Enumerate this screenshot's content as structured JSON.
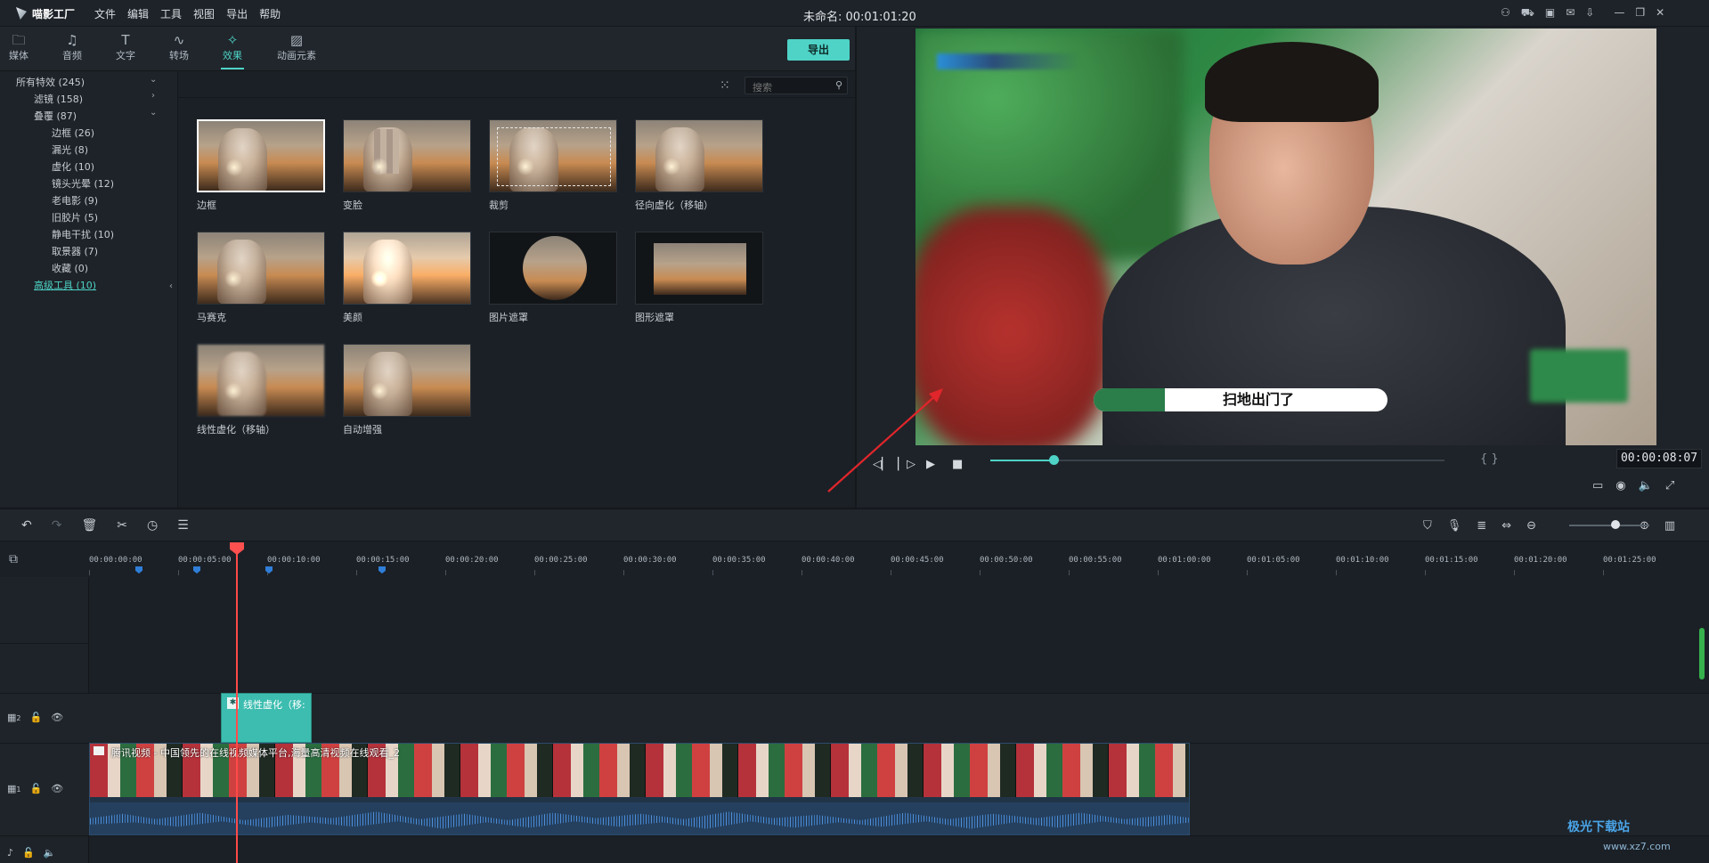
{
  "app": {
    "name": "喵影工厂",
    "doc_title": "未命名: 00:01:01:20"
  },
  "menu": [
    "文件",
    "编辑",
    "工具",
    "视图",
    "导出",
    "帮助"
  ],
  "window_controls": [
    "user-icon",
    "cart-icon",
    "save-icon",
    "mail-icon",
    "download-icon",
    "minimize-icon",
    "restore-icon",
    "close-icon"
  ],
  "tabs": [
    {
      "label": "媒体",
      "icon": "folder-icon"
    },
    {
      "label": "音频",
      "icon": "music-icon"
    },
    {
      "label": "文字",
      "icon": "text-icon"
    },
    {
      "label": "转场",
      "icon": "transition-icon"
    },
    {
      "label": "效果",
      "icon": "effects-icon",
      "active": true
    },
    {
      "label": "动画元素",
      "icon": "image-icon"
    }
  ],
  "export_label": "导出",
  "tree": {
    "root": "所有特效 (245)",
    "filters": "滤镜 (158)",
    "overlay": "叠覆 (87)",
    "children": [
      "边框 (26)",
      "漏光 (8)",
      "虚化 (10)",
      "镜头光晕 (12)",
      "老电影 (9)",
      "旧胶片 (5)",
      "静电干扰 (10)",
      "取景器 (7)",
      "收藏 (0)"
    ],
    "advanced": "高级工具 (10)"
  },
  "search": {
    "placeholder": "搜索"
  },
  "effects": [
    {
      "label": "边框"
    },
    {
      "label": "变脸"
    },
    {
      "label": "裁剪"
    },
    {
      "label": "径向虚化（移轴）"
    },
    {
      "label": "马赛克"
    },
    {
      "label": "美颜"
    },
    {
      "label": "图片遮罩"
    },
    {
      "label": "图形遮罩"
    },
    {
      "label": "线性虚化（移轴）"
    },
    {
      "label": "自动增强"
    }
  ],
  "preview": {
    "caption": "扫地出门了",
    "timecode": "00:00:08:07",
    "progress_fraction": 0.14,
    "braces": "{ }"
  },
  "timeline": {
    "ruler": [
      "00:00:00:00",
      "00:00:05:00",
      "00:00:10:00",
      "00:00:15:00",
      "00:00:20:00",
      "00:00:25:00",
      "00:00:30:00",
      "00:00:35:00",
      "00:00:40:00",
      "00:00:45:00",
      "00:00:50:00",
      "00:00:55:00",
      "00:01:00:00",
      "00:01:05:00",
      "00:01:10:00",
      "00:01:15:00",
      "00:01:20:00",
      "00:01:25:00"
    ],
    "track2_label": "2",
    "track1_label": "1",
    "fx_clip_label": "线性虚化（移:",
    "video_clip_title": "腾讯视频 - 中国领先的在线视频媒体平台,海量高清视频在线观看_2"
  },
  "watermark": {
    "brand": "极光下载站",
    "url": "www.xz7.com"
  }
}
